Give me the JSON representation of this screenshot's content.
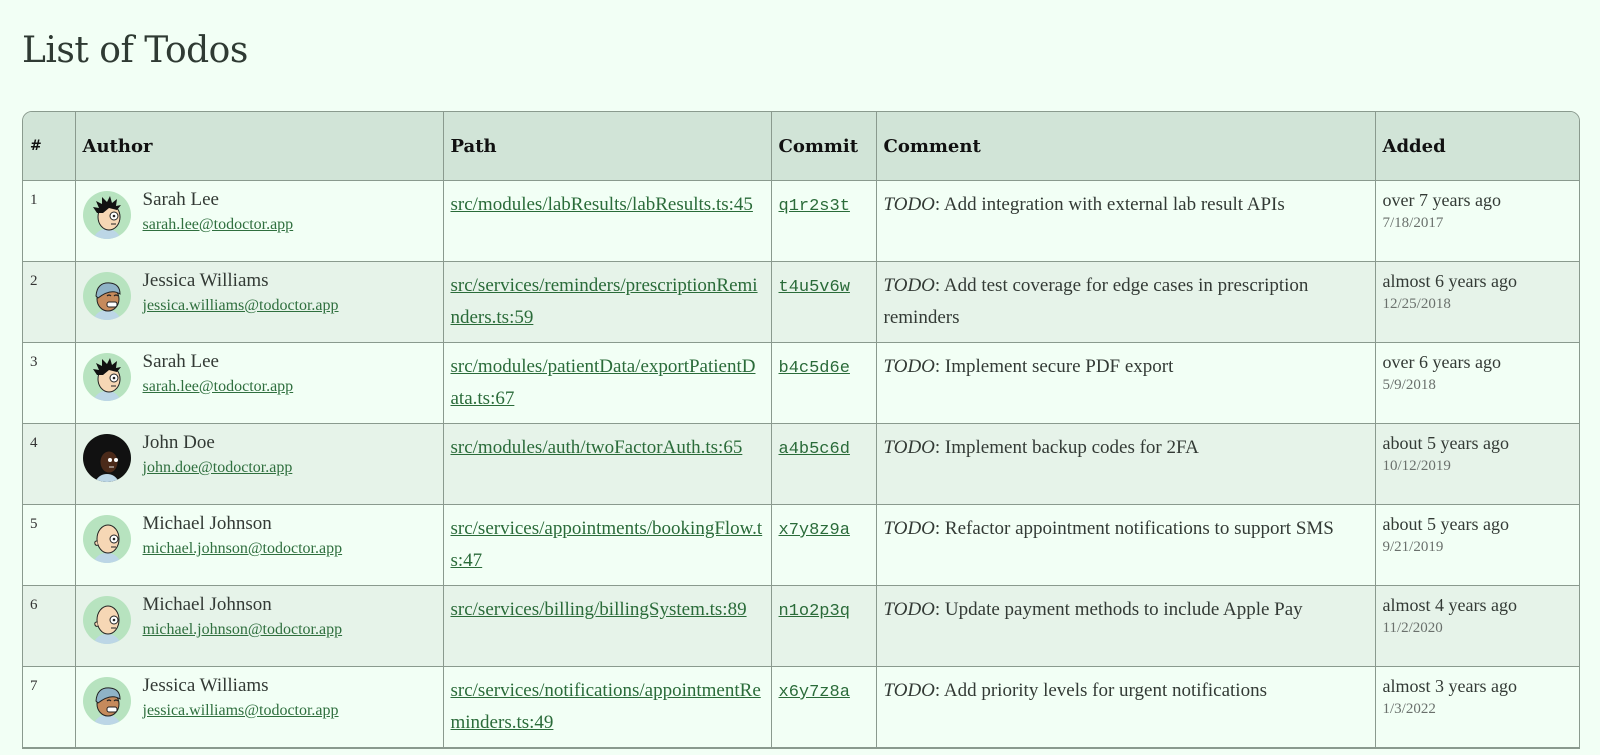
{
  "page": {
    "title": "List of Todos"
  },
  "table": {
    "columns": [
      "#",
      "Author",
      "Path",
      "Commit",
      "Comment",
      "Added"
    ],
    "rows": [
      {
        "num": "1",
        "author": {
          "name": "Sarah Lee",
          "email": "sarah.lee@todoctor.app",
          "avatar": "spiky-hair-avatar"
        },
        "path": "src/modules/labResults/labResults.ts:45",
        "commit": "q1r2s3t",
        "comment_tag": "TODO",
        "comment": ": Add integration with external lab result APIs",
        "added_relative": "over 7 years ago",
        "added_date": "7/18/2017"
      },
      {
        "num": "2",
        "author": {
          "name": "Jessica Williams",
          "email": "jessica.williams@todoctor.app",
          "avatar": "headscarf-avatar"
        },
        "path": "src/services/reminders/prescriptionReminders.ts:59",
        "commit": "t4u5v6w",
        "comment_tag": "TODO",
        "comment": ": Add test coverage for edge cases in prescription reminders",
        "added_relative": "almost 6 years ago",
        "added_date": "12/25/2018"
      },
      {
        "num": "3",
        "author": {
          "name": "Sarah Lee",
          "email": "sarah.lee@todoctor.app",
          "avatar": "spiky-hair-avatar"
        },
        "path": "src/modules/patientData/exportPatientData.ts:67",
        "commit": "b4c5d6e",
        "comment_tag": "TODO",
        "comment": ": Implement secure PDF export",
        "added_relative": "over 6 years ago",
        "added_date": "5/9/2018"
      },
      {
        "num": "4",
        "author": {
          "name": "John Doe",
          "email": "john.doe@todoctor.app",
          "avatar": "afro-avatar"
        },
        "path": "src/modules/auth/twoFactorAuth.ts:65",
        "commit": "a4b5c6d",
        "comment_tag": "TODO",
        "comment": ": Implement backup codes for 2FA",
        "added_relative": "about 5 years ago",
        "added_date": "10/12/2019"
      },
      {
        "num": "5",
        "author": {
          "name": "Michael Johnson",
          "email": "michael.johnson@todoctor.app",
          "avatar": "bald-avatar"
        },
        "path": "src/services/appointments/bookingFlow.ts:47",
        "commit": "x7y8z9a",
        "comment_tag": "TODO",
        "comment": ": Refactor appointment notifications to support SMS",
        "added_relative": "about 5 years ago",
        "added_date": "9/21/2019"
      },
      {
        "num": "6",
        "author": {
          "name": "Michael Johnson",
          "email": "michael.johnson@todoctor.app",
          "avatar": "bald-avatar"
        },
        "path": "src/services/billing/billingSystem.ts:89",
        "commit": "n1o2p3q",
        "comment_tag": "TODO",
        "comment": ": Update payment methods to include Apple Pay",
        "added_relative": "almost 4 years ago",
        "added_date": "11/2/2020"
      },
      {
        "num": "7",
        "author": {
          "name": "Jessica Williams",
          "email": "jessica.williams@todoctor.app",
          "avatar": "headscarf-avatar"
        },
        "path": "src/services/notifications/appointmentReminders.ts:49",
        "commit": "x6y7z8a",
        "comment_tag": "TODO",
        "comment": ": Add priority levels for urgent notifications",
        "added_relative": "almost 3 years ago",
        "added_date": "1/3/2022"
      }
    ]
  },
  "colors": {
    "background": "#f2fff5",
    "header": "#d1e4d7",
    "alt_row": "#e6f3e9",
    "link": "#2a6b39",
    "border": "#8a9a8e"
  }
}
